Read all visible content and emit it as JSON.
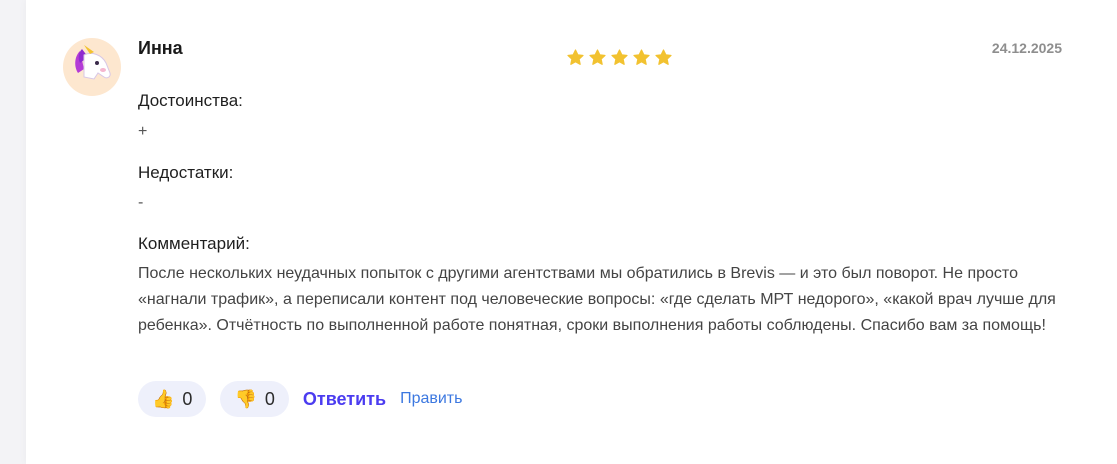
{
  "review": {
    "author": "Инна",
    "date": "24.12.2025",
    "rating": 5,
    "rating_max": 5,
    "star_color": "#f2c230",
    "pros_label": "Достоинства:",
    "pros_value": "+",
    "cons_label": "Недостатки:",
    "cons_value": "-",
    "comment_label": "Комментарий:",
    "comment_text": "После нескольких неудачных попыток с другими агентствами мы обратились в Brevis — и это был поворот. Не просто «нагнали трафик», а переписали контент под человеческие вопросы: «где сделать МРТ недорого», «какой врач лучше для ребенка». Отчётность по выполненной работе понятная, сроки выполнения работы соблюдены. Спасибо вам за помощь!"
  },
  "actions": {
    "like_icon": "👍",
    "like_count": "0",
    "dislike_icon": "👎",
    "dislike_count": "0",
    "reply_label": "Ответить",
    "edit_label": "Править",
    "reply_color": "#4b3cf0",
    "edit_color": "#3c78e0"
  },
  "avatar": {
    "icon": "unicorn-icon"
  }
}
